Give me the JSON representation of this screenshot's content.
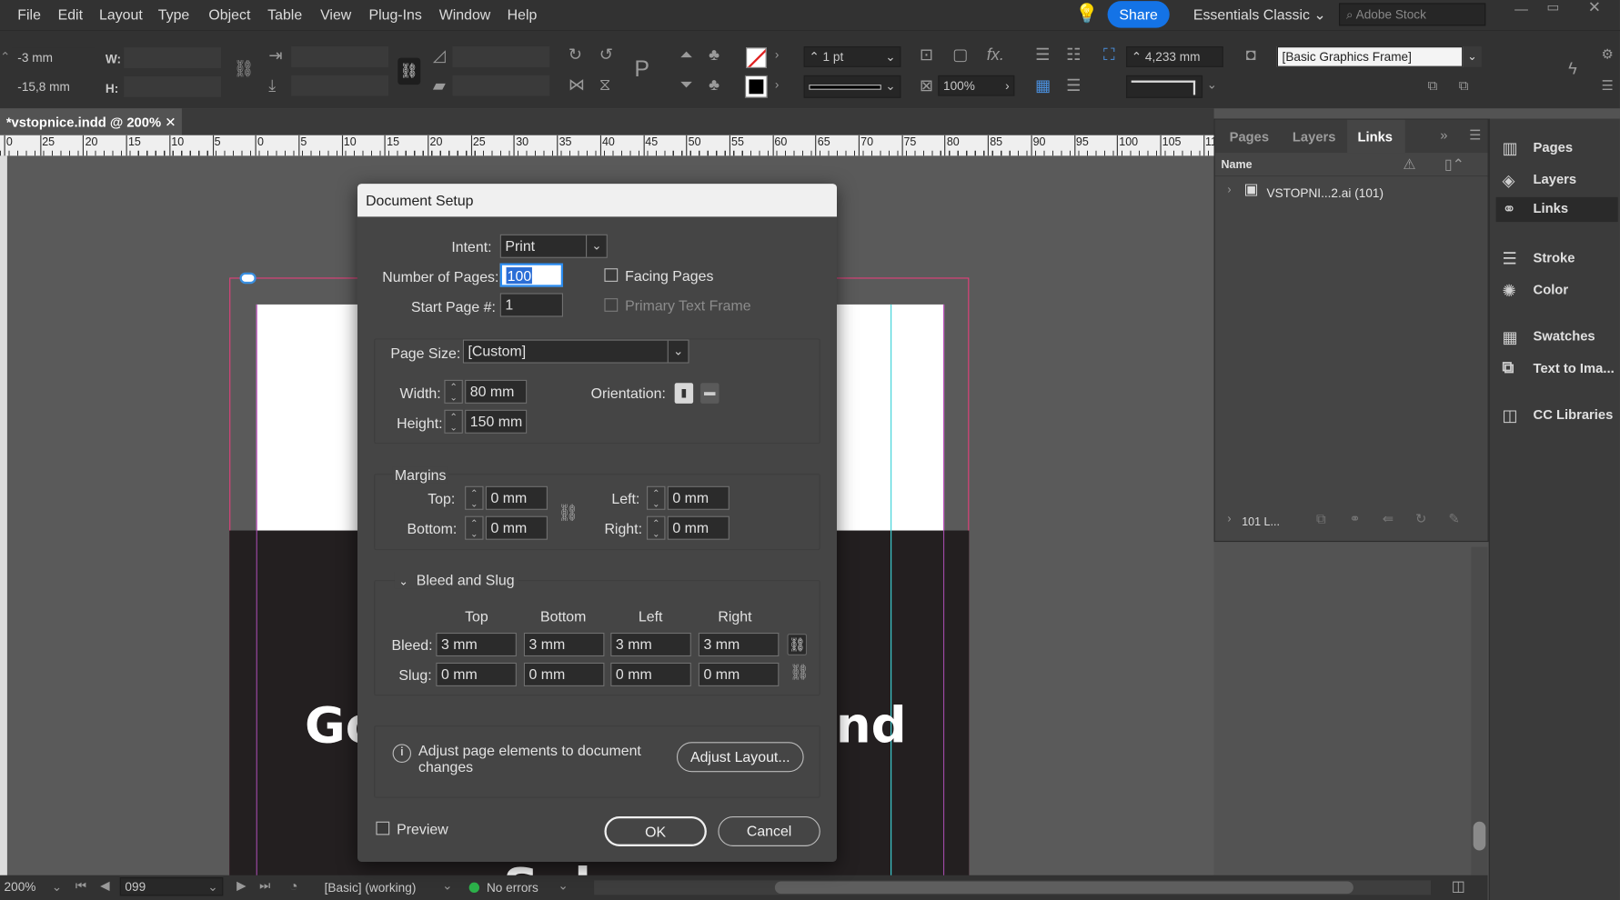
{
  "menu": [
    "File",
    "Edit",
    "Layout",
    "Type",
    "Object",
    "Table",
    "View",
    "Plug-Ins",
    "Window",
    "Help"
  ],
  "topbar": {
    "share": "Share",
    "workspace": "Essentials Classic",
    "stock_placeholder": "Adobe Stock"
  },
  "control": {
    "x": "-3 mm",
    "y": "-15,8 mm",
    "w_label": "W:",
    "h_label": "H:",
    "stroke_weight": "1 pt",
    "opacity": "100%",
    "dimension": "4,233 mm",
    "object_style": "[Basic Graphics Frame]"
  },
  "document": {
    "tab": "*vstopnice.indd @ 200%",
    "ruler": [
      "0",
      "25",
      "20",
      "15",
      "10",
      "5",
      "0",
      "5",
      "10",
      "15",
      "20",
      "25",
      "30",
      "35",
      "40",
      "45",
      "50",
      "55",
      "60",
      "65",
      "70",
      "75",
      "80",
      "85",
      "90",
      "95",
      "100",
      "105",
      "11"
    ],
    "art_left": "Go",
    "art_right": "nd",
    "art_bottom": "Sul"
  },
  "status": {
    "zoom": "200%",
    "page": "099",
    "profile": "[Basic] (working)",
    "errors": "No errors"
  },
  "links_panel": {
    "tabs": [
      "Pages",
      "Layers",
      "Links"
    ],
    "col_name": "Name",
    "item": "VSTOPNI...2.ai (101)",
    "footer": "101 L..."
  },
  "dock": [
    "Pages",
    "Layers",
    "Links",
    "Stroke",
    "Color",
    "Swatches",
    "Text to Ima...",
    "CC Libraries"
  ],
  "dialog": {
    "title": "Document Setup",
    "intent_label": "Intent:",
    "intent": "Print",
    "pages_label": "Number of Pages:",
    "pages": "100",
    "start_label": "Start Page #:",
    "start": "1",
    "facing": "Facing Pages",
    "primary": "Primary Text Frame",
    "size_label": "Page Size:",
    "size": "[Custom]",
    "width_label": "Width:",
    "width": "80 mm",
    "height_label": "Height:",
    "height": "150 mm",
    "orientation_label": "Orientation:",
    "margins_title": "Margins",
    "m_top_label": "Top:",
    "m_top": "0 mm",
    "m_bottom_label": "Bottom:",
    "m_bottom": "0 mm",
    "m_left_label": "Left:",
    "m_left": "0 mm",
    "m_right_label": "Right:",
    "m_right": "0 mm",
    "bleed_title": "Bleed and Slug",
    "cols": [
      "Top",
      "Bottom",
      "Left",
      "Right"
    ],
    "bleed_label": "Bleed:",
    "bleed": [
      "3 mm",
      "3 mm",
      "3 mm",
      "3 mm"
    ],
    "slug_label": "Slug:",
    "slug": [
      "0 mm",
      "0 mm",
      "0 mm",
      "0 mm"
    ],
    "adjust_text": "Adjust page elements to document changes",
    "adjust_button": "Adjust Layout...",
    "preview": "Preview",
    "ok": "OK",
    "cancel": "Cancel"
  }
}
